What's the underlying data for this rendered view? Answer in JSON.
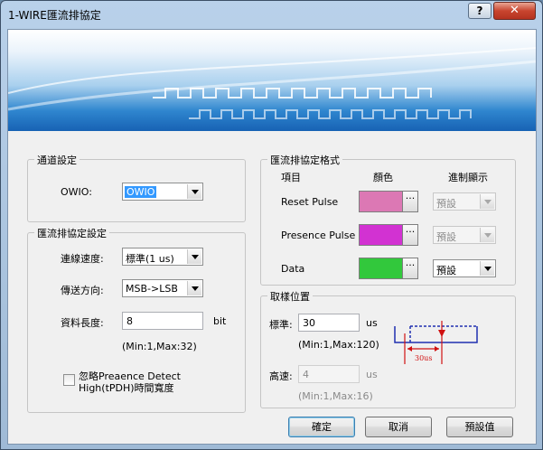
{
  "window": {
    "title": "1-WIRE匯流排協定",
    "help": "?",
    "close": "✕"
  },
  "channel": {
    "group_title": "通道設定",
    "owio_label": "OWIO:",
    "owio_value": "OWIO"
  },
  "bus_settings": {
    "group_title": "匯流排協定設定",
    "speed_label": "連線速度:",
    "speed_value": "標準(1 us)",
    "direction_label": "傳送方向:",
    "direction_value": "MSB->LSB",
    "length_label": "資料長度:",
    "length_value": "8",
    "length_unit": "bit",
    "length_range": "(Min:1,Max:32)",
    "ignore_label_line1": "忽略Preaence Detect",
    "ignore_label_line2": "High(tPDH)時間寬度",
    "ignore_checked": false
  },
  "format": {
    "group_title": "匯流排協定格式",
    "col_item": "項目",
    "col_color": "顏色",
    "col_radix": "進制顯示",
    "rows": [
      {
        "label": "Reset Pulse",
        "color": "#dc78b4",
        "radix": "預設",
        "enabled": false
      },
      {
        "label": "Presence Pulse",
        "color": "#d232d2",
        "radix": "預設",
        "enabled": false
      },
      {
        "label": "Data",
        "color": "#32c83c",
        "radix": "預設",
        "enabled": true
      }
    ],
    "dots": "···"
  },
  "sampling": {
    "group_title": "取樣位置",
    "standard_label": "標準:",
    "standard_value": "30",
    "standard_unit": "us",
    "standard_range": "(Min:1,Max:120)",
    "high_label": "高速:",
    "high_value": "4",
    "high_unit": "us",
    "high_range": "(Min:1,Max:16)",
    "diagram_label": "30us"
  },
  "buttons": {
    "ok": "確定",
    "cancel": "取消",
    "default": "預設值"
  }
}
